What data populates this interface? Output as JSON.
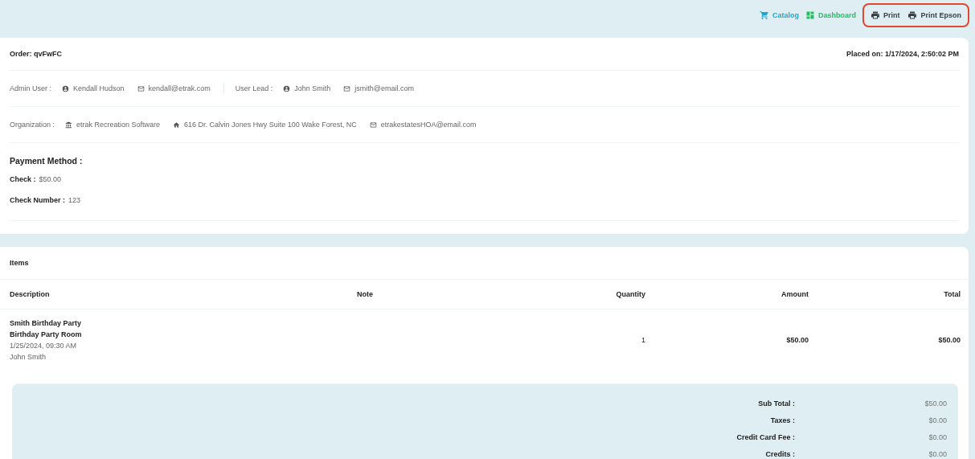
{
  "toolbar": {
    "links": [
      {
        "label": "Catalog",
        "kind": "catalog"
      },
      {
        "label": "Dashboard",
        "kind": "dashboard"
      }
    ],
    "print_actions": [
      {
        "label": "Print",
        "kind": "print"
      },
      {
        "label": "Print Epson",
        "kind": "print"
      }
    ],
    "print_actions_highlighted": true
  },
  "order": {
    "title": "Order: qvFwFC",
    "placed_on": "Placed on: 1/17/2024, 2:50:02 PM",
    "admin_user": {
      "label": "Admin User :",
      "name": "Kendall Hudson",
      "email": "kendall@etrak.com"
    },
    "user_lead": {
      "label": "User Lead :",
      "name": "John Smith",
      "email": "jsmith@email.com"
    },
    "organization": {
      "label": "Organization :",
      "name": "etrak Recreation Software",
      "address": "616 Dr. Calvin Jones Hwy Suite 100 Wake Forest, NC",
      "email": "etrakestatesHOA@email.com"
    },
    "payment": {
      "heading": "Payment Method :",
      "fields": [
        {
          "label": "Check :",
          "value": "$50.00"
        },
        {
          "label": "Check Number :",
          "value": "123"
        }
      ]
    }
  },
  "items": {
    "title": "Items",
    "columns": [
      "Description",
      "Note",
      "Quantity",
      "Amount",
      "Total"
    ],
    "rows": [
      {
        "lines": [
          {
            "text": "Smith Birthday Party",
            "kind": "strong"
          },
          {
            "text": "Birthday Party Room",
            "kind": "strong"
          },
          {
            "text": "1/25/2024, 09:30 AM",
            "kind": "muted"
          },
          {
            "text": "John Smith",
            "kind": "muted"
          }
        ],
        "quantity": "1",
        "amount": "$50.00",
        "total": "$50.00"
      }
    ],
    "summary": [
      {
        "label": "Sub Total :",
        "value": "$50.00"
      },
      {
        "label": "Taxes :",
        "value": "$0.00"
      },
      {
        "label": "Credit Card Fee :",
        "value": "$0.00"
      },
      {
        "label": "Credits :",
        "value": "$0.00"
      }
    ]
  }
}
